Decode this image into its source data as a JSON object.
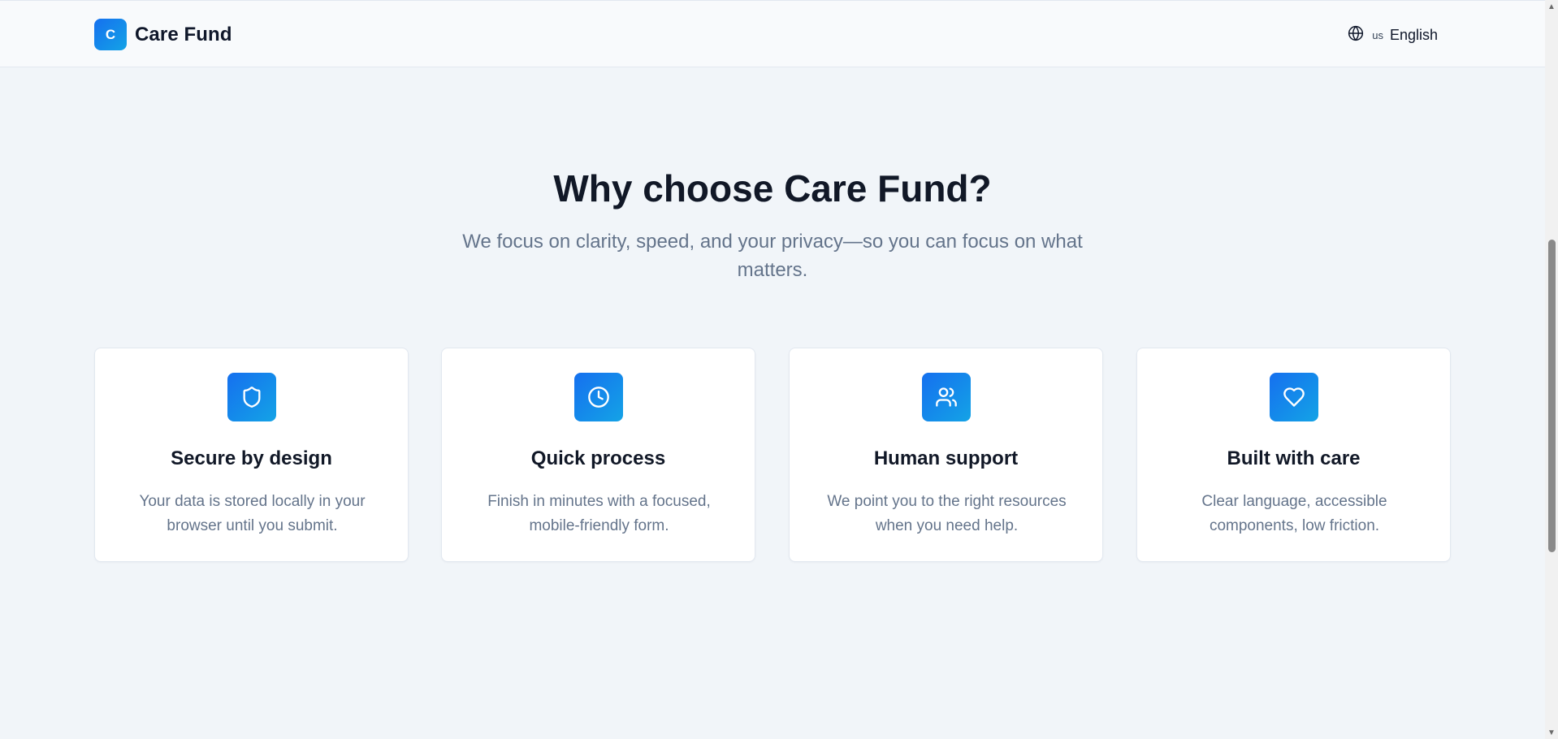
{
  "header": {
    "logo_letter": "C",
    "brand_name": "Care Fund",
    "language": {
      "flag": "us",
      "label": "English",
      "icon": "globe-icon"
    }
  },
  "hero": {
    "title": "Why choose Care Fund?",
    "subtitle": "We focus on clarity, speed, and your privacy—so you can focus on what matters."
  },
  "features": [
    {
      "icon": "shield-icon",
      "title": "Secure by design",
      "description": "Your data is stored locally in your browser until you submit."
    },
    {
      "icon": "clock-icon",
      "title": "Quick process",
      "description": "Finish in minutes with a focused, mobile-friendly form."
    },
    {
      "icon": "users-icon",
      "title": "Human support",
      "description": "We point you to the right resources when you need help."
    },
    {
      "icon": "heart-icon",
      "title": "Built with care",
      "description": "Clear language, accessible components, low friction."
    }
  ],
  "colors": {
    "accent_start": "#1570ef",
    "accent_end": "#14a3e6",
    "background": "#f1f5f9",
    "heading": "#111827",
    "muted_text": "#64748b"
  }
}
